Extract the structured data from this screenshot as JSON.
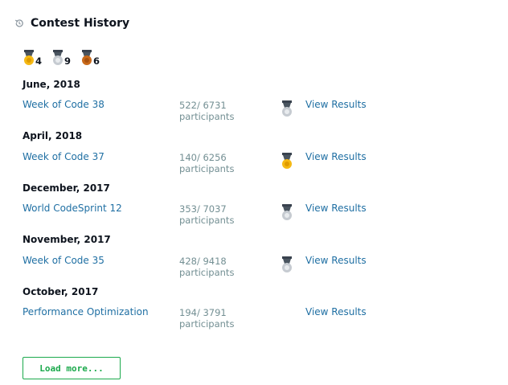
{
  "section": {
    "title": "Contest History",
    "icon": "history-icon"
  },
  "medal_summary": [
    {
      "type": "gold",
      "count": "4",
      "color": "#f5b914"
    },
    {
      "type": "silver",
      "count": "9",
      "color": "#c6cbd1"
    },
    {
      "type": "bronze",
      "count": "6",
      "color": "#c96a1a"
    }
  ],
  "months": [
    "June, 2018",
    "April, 2018",
    "December, 2017",
    "November, 2017",
    "October, 2017"
  ],
  "contests": [
    {
      "name": "Week of Code 38",
      "rank": "522/ 6731",
      "participants": "participants",
      "medal": "silver",
      "link": "View Results"
    },
    {
      "name": "Week of Code 37",
      "rank": "140/ 6256",
      "participants": "participants",
      "medal": "gold",
      "link": "View Results"
    },
    {
      "name": "World CodeSprint 12",
      "rank": "353/ 7037",
      "participants": "participants",
      "medal": "silver",
      "link": "View Results"
    },
    {
      "name": "Week of Code 35",
      "rank": "428/ 9418",
      "participants": "participants",
      "medal": "silver",
      "link": "View Results"
    },
    {
      "name": "Performance Optimization",
      "rank": "194/ 3791",
      "participants": "participants",
      "medal": "none",
      "link": "View Results"
    }
  ],
  "load_more": "Load more...",
  "colors": {
    "accent_green": "#1ba94c",
    "link_blue": "#1f6fa3",
    "ribbon": "#39424e"
  }
}
